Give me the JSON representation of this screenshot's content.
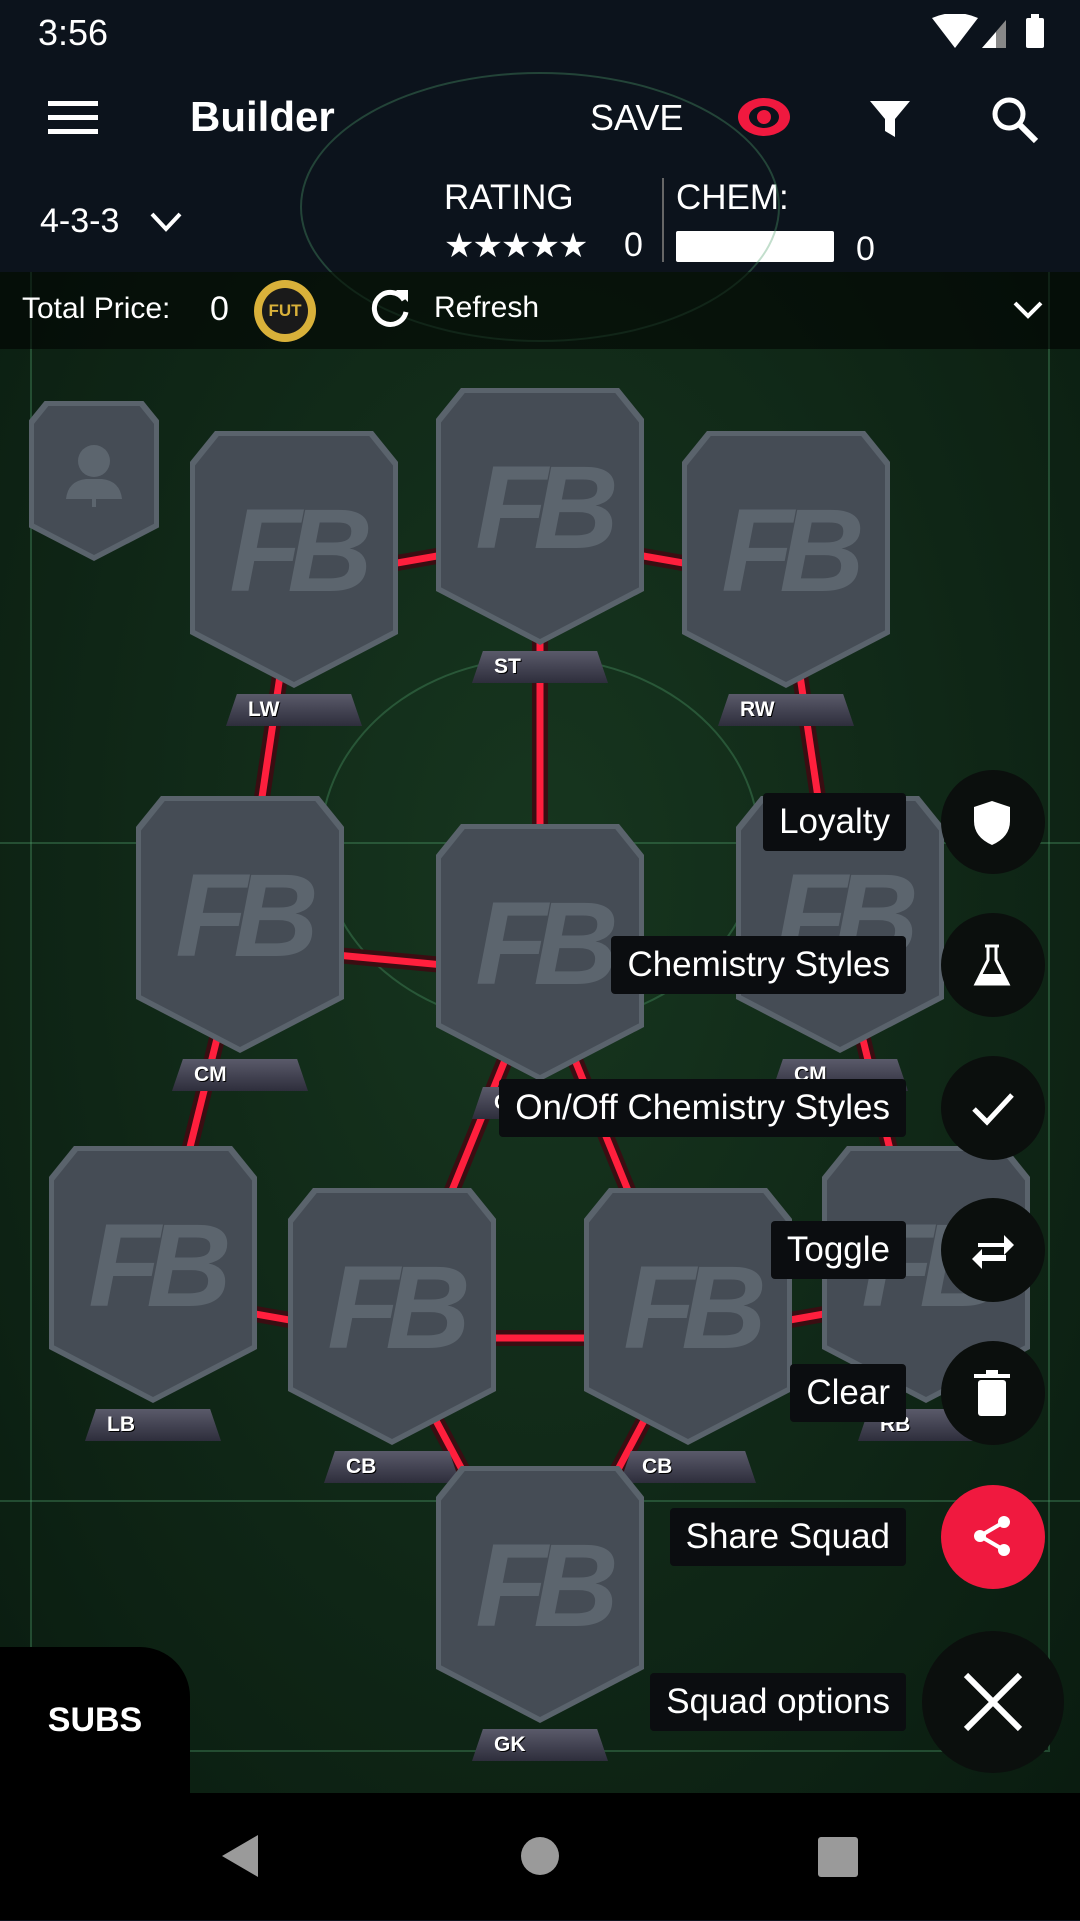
{
  "status_bar": {
    "time": "3:56",
    "icons": [
      "wifi-icon",
      "signal-icon",
      "battery-icon"
    ]
  },
  "toolbar": {
    "title": "Builder",
    "save_label": "SAVE",
    "accent": "#f0193f",
    "icons": [
      "menu-icon",
      "eye-icon",
      "filter-icon",
      "search-icon"
    ]
  },
  "stats": {
    "formation": "4-3-3",
    "rating_label": "RATING",
    "rating_stars": 5,
    "rating_value": "0",
    "chem_label": "CHEM:",
    "chem_value": "0",
    "chem_progress": 0
  },
  "price": {
    "label": "Total Price:",
    "value": "0",
    "coin": "FUT",
    "refresh_label": "Refresh"
  },
  "cards": [
    {
      "position": "ST"
    },
    {
      "position": "LW"
    },
    {
      "position": "RW"
    },
    {
      "position": "CM"
    },
    {
      "position": "CM"
    },
    {
      "position": "CM"
    },
    {
      "position": "LB"
    },
    {
      "position": "CB"
    },
    {
      "position": "CB"
    },
    {
      "position": "RB"
    },
    {
      "position": "GK"
    }
  ],
  "logo_text": "FB",
  "link_color": "#ff1f3d",
  "fab_menu": [
    {
      "label": "Loyalty",
      "icon": "shield-icon"
    },
    {
      "label": "Chemistry Styles",
      "icon": "flask-icon"
    },
    {
      "label": "On/Off Chemistry Styles",
      "icon": "check-icon"
    },
    {
      "label": "Toggle",
      "icon": "swap-icon"
    },
    {
      "label": "Clear",
      "icon": "trash-icon"
    },
    {
      "label": "Share Squad",
      "icon": "share-icon"
    },
    {
      "label": "Squad options",
      "icon": "close-icon"
    }
  ],
  "subs_label": "SUBS"
}
